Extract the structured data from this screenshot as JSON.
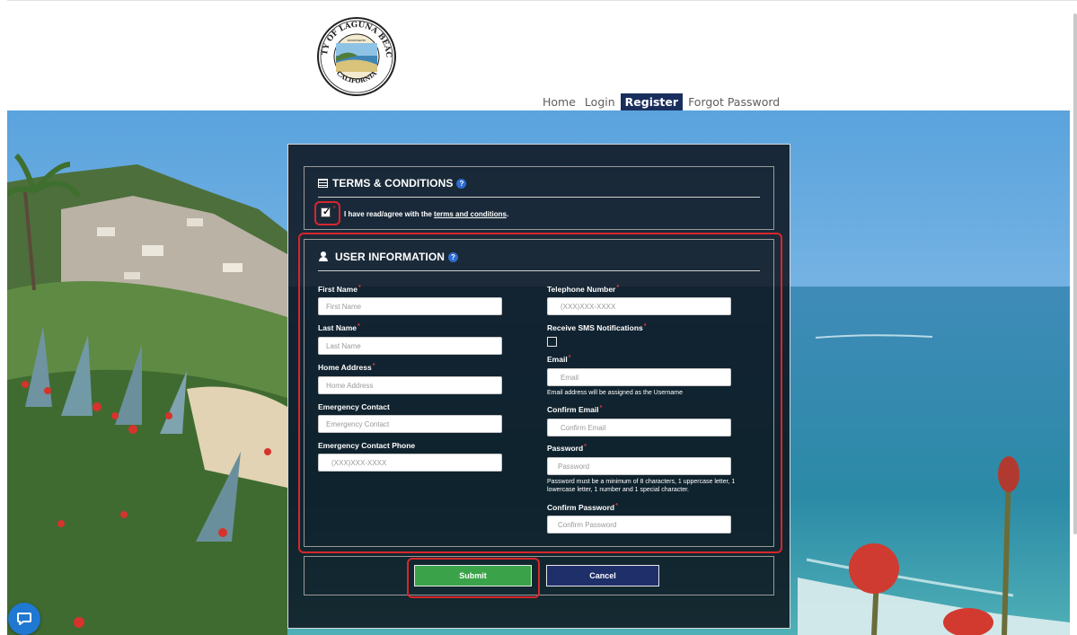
{
  "header": {
    "seal": {
      "top_text": "CITY OF LAGUNA BEACH",
      "bottom_text": "CALIFORNIA",
      "inner_text": "INCORPORATED"
    }
  },
  "nav": {
    "items": [
      {
        "label": "Home"
      },
      {
        "label": "Login"
      },
      {
        "label": "Register"
      },
      {
        "label": "Forgot Password"
      }
    ]
  },
  "terms": {
    "title": "TERMS & CONDITIONS",
    "help": "?",
    "agree_text": "I have read/agree with the ",
    "link_text": "terms and conditions",
    "period": ".",
    "checked": true
  },
  "user_info": {
    "title": "USER INFORMATION",
    "help": "?",
    "left": {
      "first_name": {
        "label": "First Name",
        "placeholder": "First Name"
      },
      "last_name": {
        "label": "Last Name",
        "placeholder": "Last Name"
      },
      "home_address": {
        "label": "Home Address",
        "placeholder": "Home Address"
      },
      "emergency_contact": {
        "label": "Emergency Contact",
        "placeholder": "Emergency Contact"
      },
      "emergency_phone": {
        "label": "Emergency Contact Phone",
        "placeholder": "(XXX)XXX-XXXX"
      }
    },
    "right": {
      "telephone": {
        "label": "Telephone Number",
        "placeholder": "(XXX)XXX-XXXX"
      },
      "sms": {
        "label": "Receive SMS Notifications"
      },
      "email": {
        "label": "Email",
        "placeholder": "Email",
        "note": "Email address will be assigned as the Username"
      },
      "confirm_email": {
        "label": "Confirm Email",
        "placeholder": "Confirm Email"
      },
      "password": {
        "label": "Password",
        "placeholder": "Password",
        "note": "Password must be a minimum of 8 characters, 1 uppercase letter, 1 lowercase letter, 1 number and 1 special character."
      },
      "confirm_password": {
        "label": "Confirm Password",
        "placeholder": "Confirm Password"
      }
    },
    "required_mark": "*"
  },
  "actions": {
    "submit": "Submit",
    "cancel": "Cancel"
  },
  "colors": {
    "nav_active_bg": "#1a2e5e",
    "submit_bg": "#3aa34a",
    "cancel_bg": "#1e2f6a",
    "highlight": "#d8262a",
    "help_icon": "#2e6bd1"
  }
}
